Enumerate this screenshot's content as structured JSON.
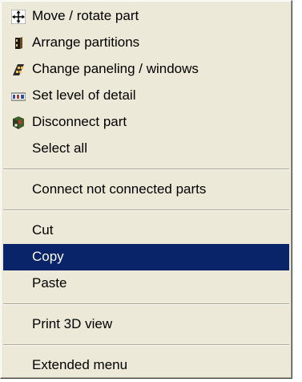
{
  "menu": {
    "groups": [
      {
        "items": [
          {
            "label": "Move / rotate part",
            "icon": "move-rotate-icon"
          },
          {
            "label": "Arrange partitions",
            "icon": "partitions-icon"
          },
          {
            "label": "Change paneling / windows",
            "icon": "paneling-windows-icon"
          },
          {
            "label": "Set level of detail",
            "icon": "level-of-detail-icon"
          },
          {
            "label": "Disconnect part",
            "icon": "disconnect-part-icon"
          },
          {
            "label": "Select all",
            "icon": ""
          }
        ]
      },
      {
        "items": [
          {
            "label": "Connect not connected parts",
            "icon": ""
          }
        ]
      },
      {
        "items": [
          {
            "label": "Cut",
            "icon": ""
          },
          {
            "label": "Copy",
            "icon": "",
            "selected": true
          },
          {
            "label": "Paste",
            "icon": ""
          }
        ]
      },
      {
        "items": [
          {
            "label": "Print 3D view",
            "icon": ""
          }
        ]
      },
      {
        "items": [
          {
            "label": "Extended menu",
            "icon": ""
          }
        ]
      }
    ]
  },
  "colors": {
    "menu_bg": "#ece9d8",
    "highlight_bg": "#0a246a",
    "highlight_text": "#ffffff",
    "text": "#000000"
  }
}
